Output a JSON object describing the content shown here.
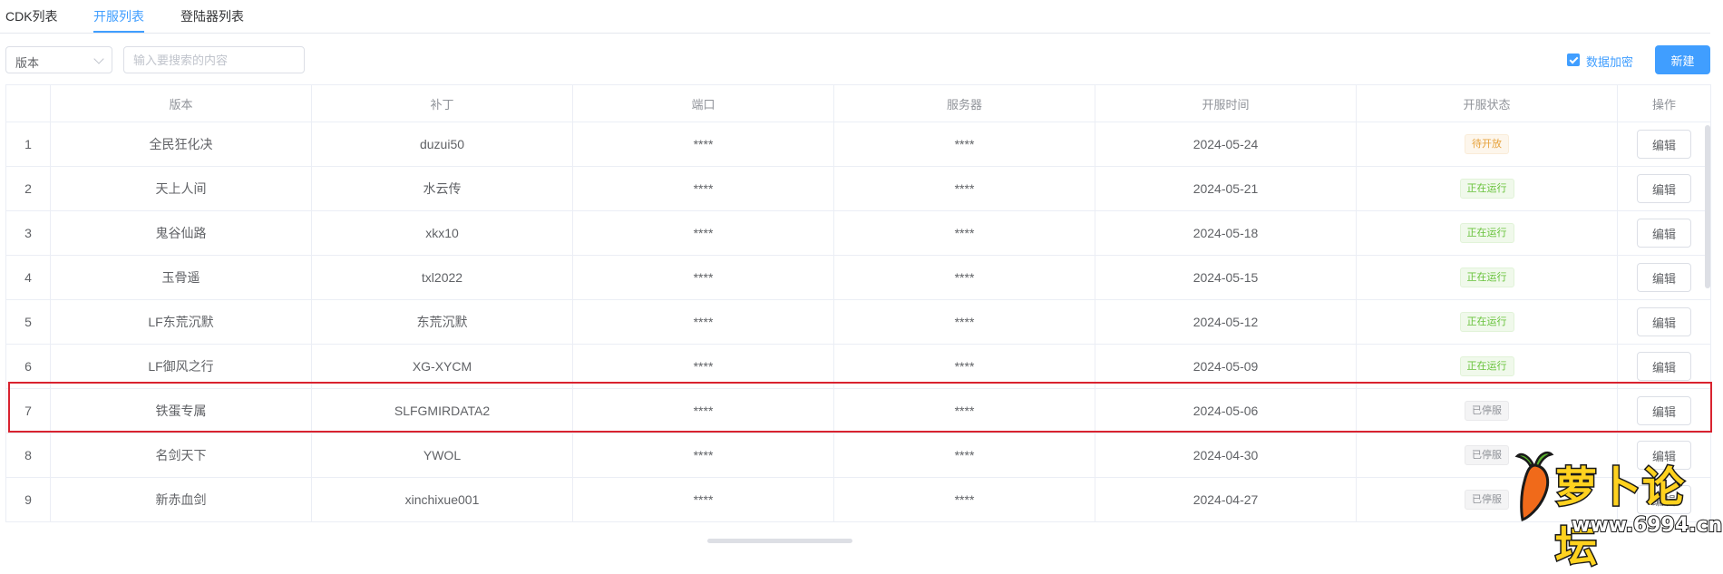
{
  "tabs": [
    {
      "label": "CDK列表",
      "active": false
    },
    {
      "label": "开服列表",
      "active": true
    },
    {
      "label": "登陆器列表",
      "active": false
    }
  ],
  "toolbar": {
    "version_select": "版本",
    "search_placeholder": "输入要搜索的内容",
    "encrypt_label": "数据加密",
    "encrypt_checked": true,
    "new_button": "新建"
  },
  "table": {
    "headers": [
      "",
      "版本",
      "补丁",
      "端口",
      "服务器",
      "开服时间",
      "开服状态",
      "操作"
    ],
    "rows": [
      {
        "index": "1",
        "version": "全民狂化决",
        "patch": "duzui50",
        "port": "****",
        "server": "****",
        "open_time": "2024-05-24",
        "status": "待开放",
        "status_type": "warn",
        "action": "编辑"
      },
      {
        "index": "2",
        "version": "天上人间",
        "patch": "水云传",
        "port": "****",
        "server": "****",
        "open_time": "2024-05-21",
        "status": "正在运行",
        "status_type": "ok",
        "action": "编辑"
      },
      {
        "index": "3",
        "version": "鬼谷仙路",
        "patch": "xkx10",
        "port": "****",
        "server": "****",
        "open_time": "2024-05-18",
        "status": "正在运行",
        "status_type": "ok",
        "action": "编辑"
      },
      {
        "index": "4",
        "version": "玉骨遥",
        "patch": "txl2022",
        "port": "****",
        "server": "****",
        "open_time": "2024-05-15",
        "status": "正在运行",
        "status_type": "ok",
        "action": "编辑"
      },
      {
        "index": "5",
        "version": "LF东荒沉默",
        "patch": "东荒沉默",
        "port": "****",
        "server": "****",
        "open_time": "2024-05-12",
        "status": "正在运行",
        "status_type": "ok",
        "action": "编辑"
      },
      {
        "index": "6",
        "version": "LF御风之行",
        "patch": "XG-XYCM",
        "port": "****",
        "server": "****",
        "open_time": "2024-05-09",
        "status": "正在运行",
        "status_type": "ok",
        "action": "编辑"
      },
      {
        "index": "7",
        "version": "铁蛋专属",
        "patch": "SLFGMIRDATA2",
        "port": "****",
        "server": "****",
        "open_time": "2024-05-06",
        "status": "已停服",
        "status_type": "stop",
        "action": "编辑"
      },
      {
        "index": "8",
        "version": "名剑天下",
        "patch": "YWOL",
        "port": "****",
        "server": "****",
        "open_time": "2024-04-30",
        "status": "已停服",
        "status_type": "stop",
        "action": "编辑"
      },
      {
        "index": "9",
        "version": "新赤血剑",
        "patch": "xinchixue001",
        "port": "****",
        "server": "****",
        "open_time": "2024-04-27",
        "status": "已停服",
        "status_type": "stop",
        "action": "编辑"
      }
    ]
  },
  "watermark": {
    "name": "萝卜论坛",
    "url": "www.6994.cn"
  },
  "colors": {
    "primary": "#409eff",
    "highlight": "#d9232f",
    "logo": "#ffd21f"
  }
}
